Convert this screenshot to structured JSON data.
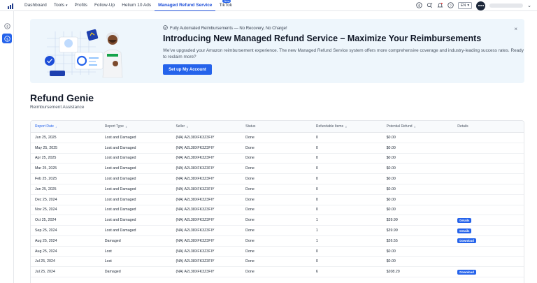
{
  "nav": {
    "items": [
      {
        "label": "Dashboard",
        "active": false,
        "dropdown": false,
        "badge": ""
      },
      {
        "label": "Tools",
        "active": false,
        "dropdown": true,
        "badge": ""
      },
      {
        "label": "Profits",
        "active": false,
        "dropdown": false,
        "badge": ""
      },
      {
        "label": "Follow-Up",
        "active": false,
        "dropdown": false,
        "badge": ""
      },
      {
        "label": "Helium 10 Ads",
        "active": false,
        "dropdown": false,
        "badge": ""
      },
      {
        "label": "Managed Refund Service",
        "active": true,
        "dropdown": false,
        "badge": ""
      },
      {
        "label": "TikTok",
        "active": false,
        "dropdown": false,
        "badge": "New"
      }
    ],
    "language": "EN",
    "icons": [
      "dollar-circle-icon",
      "sparkle-search-icon",
      "bell-icon",
      "help-icon",
      "avatar",
      "chevron-down-icon"
    ]
  },
  "sidebar": {
    "items": [
      {
        "icon": "dollar-outline-icon",
        "active": false
      },
      {
        "icon": "dollar-active-icon",
        "active": true
      }
    ]
  },
  "banner": {
    "subtitle": "Fully Automated Reimbursements — No Recovery, No Charge!",
    "title": "Introducing New Managed Refund Service – Maximize Your Reimbursements",
    "description": "We've upgraded your Amazon reimbursement experience. The new Managed Refund Service system offers more comprehensive coverage and industry-leading success rates. Ready to reclaim more?",
    "button": "Set up My Account",
    "close": "×"
  },
  "page": {
    "title": "Refund Genie",
    "subtitle": "Reimbursement Assistance"
  },
  "table": {
    "columns": [
      {
        "label": "Report Date",
        "sort": "↓",
        "sorted": true
      },
      {
        "label": "Report Type",
        "sort": "⇕",
        "sorted": false
      },
      {
        "label": "Seller",
        "sort": "⇕",
        "sorted": false
      },
      {
        "label": "Status",
        "sort": "",
        "sorted": false
      },
      {
        "label": "Refundable Items",
        "sort": "⇕",
        "sorted": false
      },
      {
        "label": "Potential Refund",
        "sort": "⇕",
        "sorted": false
      },
      {
        "label": "Details",
        "sort": "",
        "sorted": false
      }
    ],
    "rows": [
      {
        "date": "Jun 25, 2025",
        "type": "Lost and Damaged",
        "seller": "(NA) A2L38XFK3Z3FIY",
        "status": "Done",
        "items": "0",
        "refund": "$0.00",
        "action": ""
      },
      {
        "date": "May 25, 2025",
        "type": "Lost and Damaged",
        "seller": "(NA) A2L38XFK3Z3FIY",
        "status": "Done",
        "items": "0",
        "refund": "$0.00",
        "action": ""
      },
      {
        "date": "Apr 25, 2025",
        "type": "Lost and Damaged",
        "seller": "(NA) A2L38XFK3Z3FIY",
        "status": "Done",
        "items": "0",
        "refund": "$0.00",
        "action": ""
      },
      {
        "date": "Mar 25, 2025",
        "type": "Lost and Damaged",
        "seller": "(NA) A2L38XFK3Z3FIY",
        "status": "Done",
        "items": "0",
        "refund": "$0.00",
        "action": ""
      },
      {
        "date": "Feb 25, 2025",
        "type": "Lost and Damaged",
        "seller": "(NA) A2L38XFK3Z3FIY",
        "status": "Done",
        "items": "0",
        "refund": "$0.00",
        "action": ""
      },
      {
        "date": "Jan 25, 2025",
        "type": "Lost and Damaged",
        "seller": "(NA) A2L38XFK3Z3FIY",
        "status": "Done",
        "items": "0",
        "refund": "$0.00",
        "action": ""
      },
      {
        "date": "Dec 25, 2024",
        "type": "Lost and Damaged",
        "seller": "(NA) A2L38XFK3Z3FIY",
        "status": "Done",
        "items": "0",
        "refund": "$0.00",
        "action": ""
      },
      {
        "date": "Nov 25, 2024",
        "type": "Lost and Damaged",
        "seller": "(NA) A2L38XFK3Z3FIY",
        "status": "Done",
        "items": "0",
        "refund": "$0.00",
        "action": ""
      },
      {
        "date": "Oct 25, 2024",
        "type": "Lost and Damaged",
        "seller": "(NA) A2L38XFK3Z3FIY",
        "status": "Done",
        "items": "1",
        "refund": "$39.99",
        "action": "Details"
      },
      {
        "date": "Sep 25, 2024",
        "type": "Lost and Damaged",
        "seller": "(NA) A2L38XFK3Z3FIY",
        "status": "Done",
        "items": "1",
        "refund": "$39.99",
        "action": "Details"
      },
      {
        "date": "Aug 25, 2024",
        "type": "Damaged",
        "seller": "(NA) A2L38XFK3Z3FIY",
        "status": "Done",
        "items": "1",
        "refund": "$26.55",
        "action": "Download"
      },
      {
        "date": "Aug 25, 2024",
        "type": "Lost",
        "seller": "(NA) A2L38XFK3Z3FIY",
        "status": "Done",
        "items": "0",
        "refund": "$0.00",
        "action": ""
      },
      {
        "date": "Jul 25, 2024",
        "type": "Lost",
        "seller": "(NA) A2L38XFK3Z3FIY",
        "status": "Done",
        "items": "0",
        "refund": "$0.00",
        "action": ""
      },
      {
        "date": "Jul 25, 2024",
        "type": "Damaged",
        "seller": "(NA) A2L38XFK3Z3FIY",
        "status": "Done",
        "items": "6",
        "refund": "$208.20",
        "action": "Download"
      }
    ]
  },
  "colors": {
    "accent": "#2563eb",
    "banner_bg": "#eef6fc",
    "nav_dark": "#1e3a8a"
  }
}
